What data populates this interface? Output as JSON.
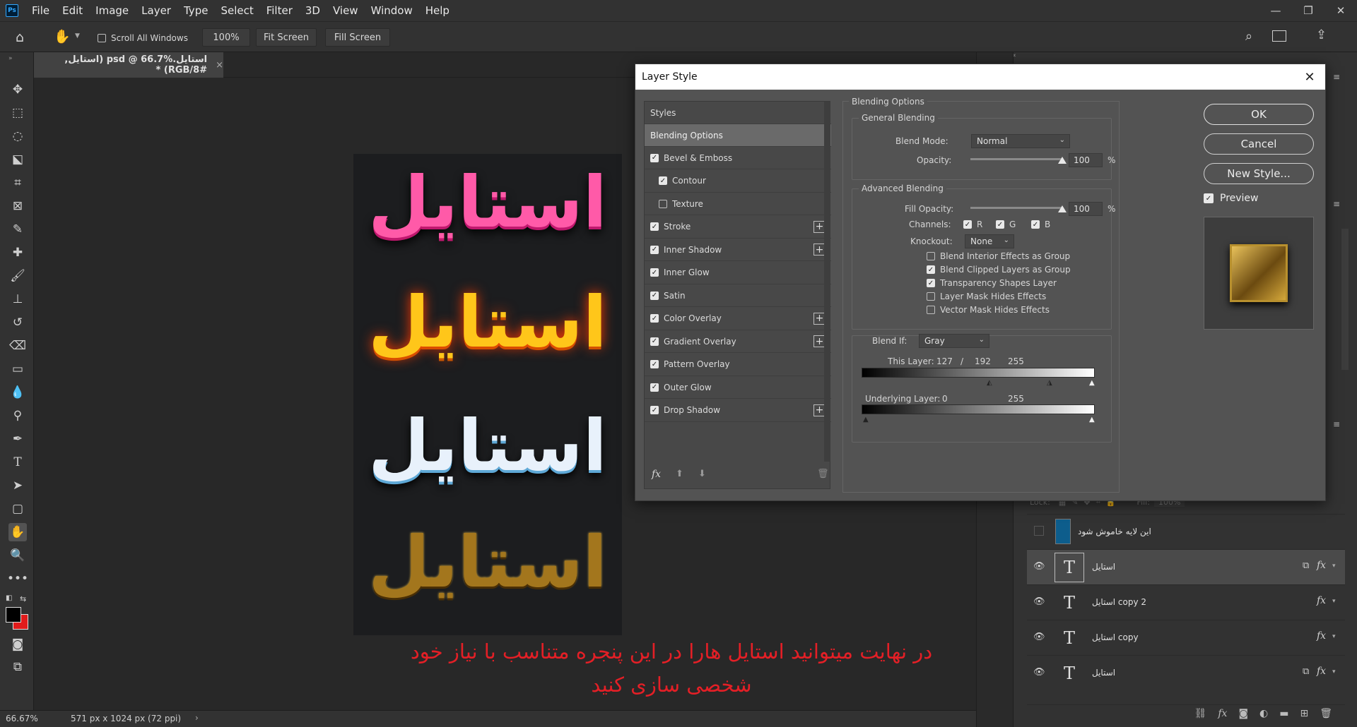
{
  "menubar": {
    "logo": "Ps",
    "items": [
      "File",
      "Edit",
      "Image",
      "Layer",
      "Type",
      "Select",
      "Filter",
      "3D",
      "View",
      "Window",
      "Help"
    ]
  },
  "options_bar": {
    "scroll_all": "Scroll All Windows",
    "zoom": "100%",
    "fit_screen": "Fit Screen",
    "fill_screen": "Fill Screen"
  },
  "document_tab": {
    "title": "استایل.psd @ 66.7% (استایل, RGB/8#) *",
    "close": "×"
  },
  "canvas": {
    "art_words": [
      "استایل",
      "استایل",
      "استایل",
      "استایل"
    ],
    "caption_line1": "در نهایت میتوانید استایل هارا در این پنجره متناسب با نیاز خود",
    "caption_line2": "شخصی سازی کنید"
  },
  "status_bar": {
    "zoom": "66.67%",
    "doc_size": "571 px x 1024 px (72 ppi)"
  },
  "layers": {
    "lock_label": "Lock:",
    "fill_label": "Fill:",
    "fill_value": "100%",
    "rows": [
      {
        "name": "این لایه خاموش شود",
        "kind": "color",
        "fx": false
      },
      {
        "name": "استایل",
        "kind": "text",
        "fx": true
      },
      {
        "name": "استایل copy 2",
        "kind": "text",
        "fx": true
      },
      {
        "name": "استایل copy",
        "kind": "text",
        "fx": true
      },
      {
        "name": "استایل",
        "kind": "text",
        "fx": true
      }
    ]
  },
  "dialog": {
    "title": "Layer Style",
    "styles_header": "Styles",
    "blending_options": "Blending Options",
    "effects": [
      {
        "label": "Bevel & Emboss",
        "checked": true,
        "plus": false,
        "indent": false
      },
      {
        "label": "Contour",
        "checked": true,
        "plus": false,
        "indent": true
      },
      {
        "label": "Texture",
        "checked": false,
        "plus": false,
        "indent": true
      },
      {
        "label": "Stroke",
        "checked": true,
        "plus": true,
        "indent": false
      },
      {
        "label": "Inner Shadow",
        "checked": true,
        "plus": true,
        "indent": false
      },
      {
        "label": "Inner Glow",
        "checked": true,
        "plus": false,
        "indent": false
      },
      {
        "label": "Satin",
        "checked": true,
        "plus": false,
        "indent": false
      },
      {
        "label": "Color Overlay",
        "checked": true,
        "plus": true,
        "indent": false
      },
      {
        "label": "Gradient Overlay",
        "checked": true,
        "plus": true,
        "indent": false
      },
      {
        "label": "Pattern Overlay",
        "checked": true,
        "plus": false,
        "indent": false
      },
      {
        "label": "Outer Glow",
        "checked": true,
        "plus": false,
        "indent": false
      },
      {
        "label": "Drop Shadow",
        "checked": true,
        "plus": true,
        "indent": false
      }
    ],
    "fx_label": "fx",
    "blending": {
      "section": "Blending Options",
      "general": "General Blending",
      "blend_mode_label": "Blend Mode:",
      "blend_mode": "Normal",
      "opacity_label": "Opacity:",
      "opacity": "100",
      "opacity_pct": 1.0,
      "percent": "%",
      "advanced": "Advanced Blending",
      "fill_opacity_label": "Fill Opacity:",
      "fill_opacity": "100",
      "fill_opacity_pct": 1.0,
      "channels_label": "Channels:",
      "channel_r": "R",
      "channel_g": "G",
      "channel_b": "B",
      "knockout_label": "Knockout:",
      "knockout": "None",
      "options": [
        {
          "label": "Blend Interior Effects as Group",
          "checked": false
        },
        {
          "label": "Blend Clipped Layers as Group",
          "checked": true
        },
        {
          "label": "Transparency Shapes Layer",
          "checked": true
        },
        {
          "label": "Layer Mask Hides Effects",
          "checked": false
        },
        {
          "label": "Vector Mask Hides Effects",
          "checked": false
        }
      ],
      "blend_if_label": "Blend If:",
      "blend_if": "Gray",
      "this_layer_label": "This Layer:",
      "this_layer_low": "127",
      "this_layer_sep": "/",
      "this_layer_mid": "192",
      "this_layer_high": "255",
      "underlying_label": "Underlying Layer:",
      "underlying_low": "0",
      "underlying_high": "255"
    },
    "buttons": {
      "ok": "OK",
      "cancel": "Cancel",
      "new_style": "New Style...",
      "preview": "Preview"
    }
  },
  "colors": {
    "foreground": "#000000",
    "background": "#e11b1b",
    "caption": "#e41f26",
    "accent": "#31a8ff"
  }
}
